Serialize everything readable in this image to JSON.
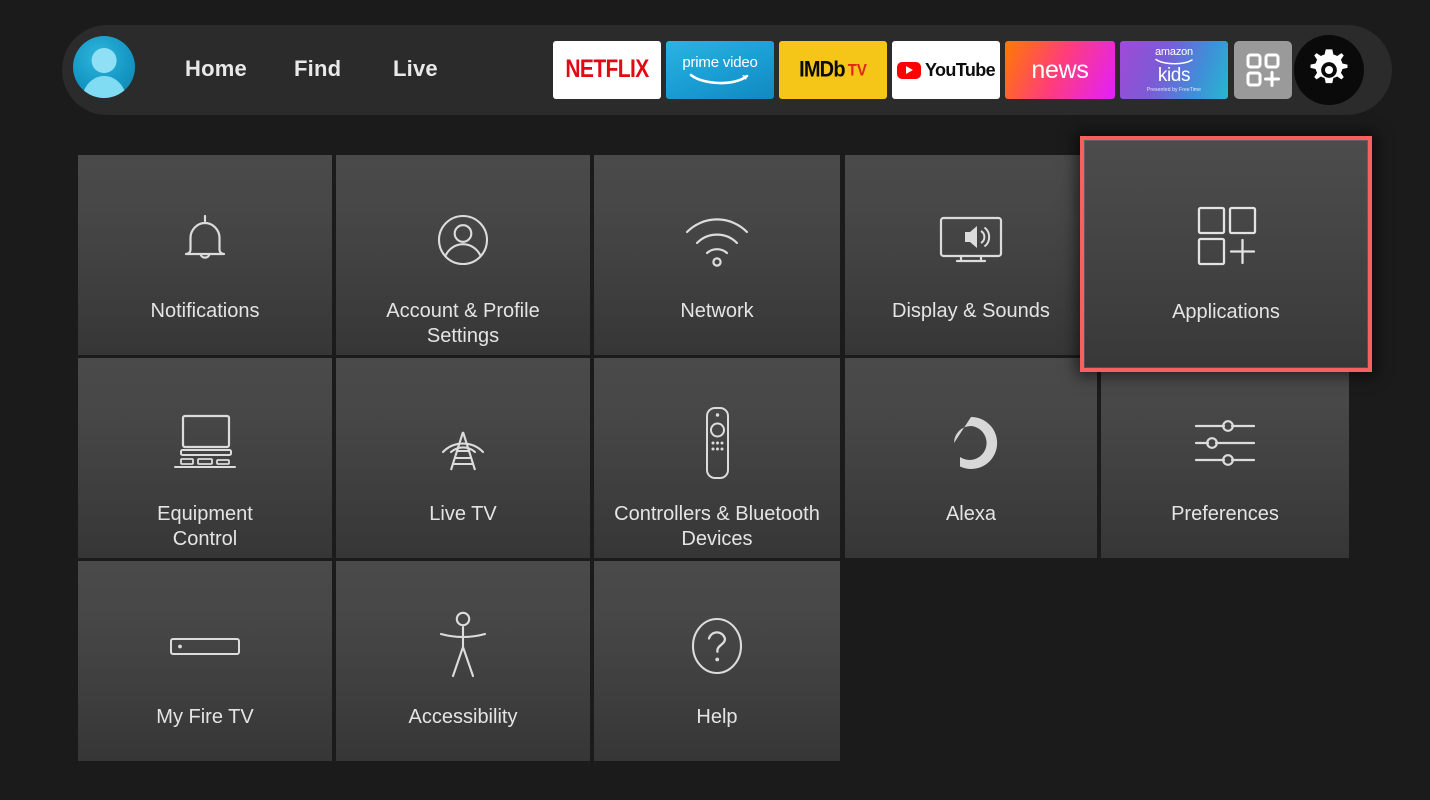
{
  "nav": {
    "avatar_name": "profile-avatar",
    "links": [
      {
        "id": "home",
        "label": "Home"
      },
      {
        "id": "find",
        "label": "Find"
      },
      {
        "id": "live",
        "label": "Live"
      }
    ],
    "apps": [
      {
        "id": "netflix",
        "label": "NETFLIX"
      },
      {
        "id": "prime",
        "label": "prime video"
      },
      {
        "id": "imdb",
        "label": "IMDb",
        "label2": "TV"
      },
      {
        "id": "youtube",
        "label": "YouTube"
      },
      {
        "id": "news",
        "label": "news"
      },
      {
        "id": "kids",
        "label": "kids",
        "label_top": "amazon",
        "sublabel": "Presented by FreeTime"
      }
    ],
    "add_apps_label": "Add apps",
    "settings_label": "Settings"
  },
  "grid": {
    "tiles": [
      {
        "id": "notifications",
        "label": "Notifications",
        "icon": "bell-icon"
      },
      {
        "id": "account",
        "label": "Account & Profile\nSettings",
        "icon": "person-circle-icon"
      },
      {
        "id": "network",
        "label": "Network",
        "icon": "wifi-icon"
      },
      {
        "id": "display",
        "label": "Display & Sounds",
        "icon": "tv-speaker-icon"
      },
      {
        "id": "applications",
        "label": "Applications",
        "icon": "apps-grid-icon",
        "focused": true
      },
      {
        "id": "equipment",
        "label": "Equipment\nControl",
        "icon": "tv-equipment-icon"
      },
      {
        "id": "livetv",
        "label": "Live TV",
        "icon": "antenna-tower-icon"
      },
      {
        "id": "controllers",
        "label": "Controllers & Bluetooth\nDevices",
        "icon": "remote-control-icon"
      },
      {
        "id": "alexa",
        "label": "Alexa",
        "icon": "alexa-ring-icon"
      },
      {
        "id": "preferences",
        "label": "Preferences",
        "icon": "sliders-icon"
      },
      {
        "id": "myfiretv",
        "label": "My Fire TV",
        "icon": "firestick-icon"
      },
      {
        "id": "accessibility",
        "label": "Accessibility",
        "icon": "accessibility-icon"
      },
      {
        "id": "help",
        "label": "Help",
        "icon": "question-circle-icon"
      }
    ]
  },
  "colors": {
    "background": "#1b1b1b",
    "navbar": "#2b2b2b",
    "tile_top": "#4a4a4a",
    "tile_bottom": "#363636",
    "focus_border": "#f4625e",
    "text": "#e4e4e4",
    "netflix_red": "#e10914",
    "imdb_yellow": "#f5c518",
    "youtube_red": "#ff0000"
  }
}
